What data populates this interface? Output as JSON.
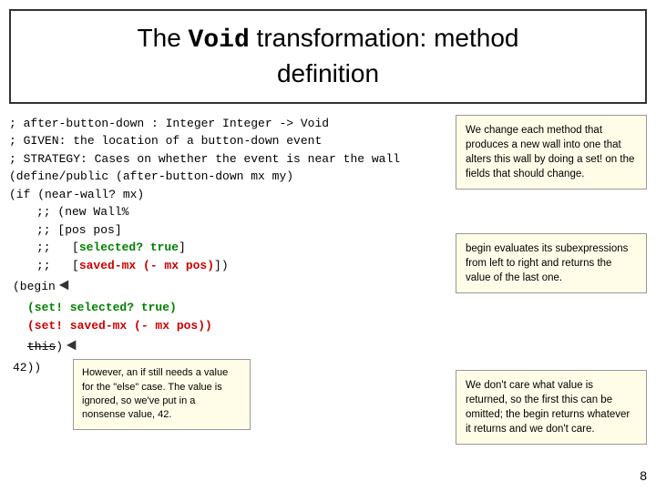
{
  "title": {
    "prefix": "The ",
    "bold": "Void",
    "suffix": " transformation: method",
    "line2": "definition"
  },
  "comments": [
    "; after-button-down : Integer Integer -> Void",
    "; GIVEN: the location of a button-down event",
    "; STRATEGY: Cases on whether the event is near the wall"
  ],
  "code_lines": [
    "(define/public (after-button-down mx my)",
    "  (if (near-wall? mx)",
    "    ;; (new Wall%",
    "    ;;   [pos pos]",
    "    ;;   [selected? true]",
    "    ;;   [saved-mx (- mx pos)])",
    "    (begin",
    "      (set! selected? true)",
    "      (set! saved-mx (- mx pos))",
    "      this)",
    "    42))"
  ],
  "tooltip_right": {
    "text": "We change each method that produces a new wall into one that alters this wall by doing a set! on the fields that should change."
  },
  "tooltip_begin": {
    "text": "begin evaluates its subexpressions from left to right and returns the value of the last one."
  },
  "tooltip_this": {
    "text": "We don't care what value is returned, so the first this can be omitted; the begin returns whatever it returns and we don't care."
  },
  "tooltip_42": {
    "text": "However, an if still needs a value for the \"else\" case. The value is ignored, so we've put in a nonsense value, 42."
  },
  "page_number": "8"
}
